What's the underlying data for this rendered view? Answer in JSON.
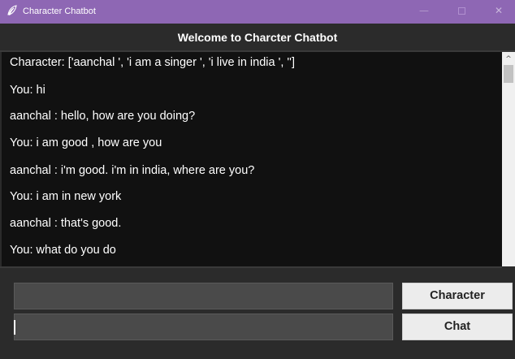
{
  "window": {
    "title": "Character Chatbot",
    "icon": "feather-icon",
    "controls": {
      "minimize": "—",
      "close": "✕"
    }
  },
  "header": {
    "title": "Welcome to Charcter Chatbot"
  },
  "chat": {
    "messages": [
      "Character: ['aanchal ', 'i am a singer ', 'i live in india ', '']",
      "You: hi",
      "aanchal : hello, how are you doing?",
      "You: i am good , how are you",
      "aanchal : i'm good. i'm in india, where are you?",
      "You: i am in new york",
      "aanchal : that's good.",
      "You: what do you do"
    ]
  },
  "scrollbar": {
    "up": "^",
    "down": "⌄"
  },
  "inputs": {
    "character_value": "",
    "chat_value": ""
  },
  "buttons": {
    "character_label": "Character",
    "chat_label": "Chat"
  },
  "colors": {
    "titlebar": "#8e67b4",
    "background": "#2b2b2b",
    "chat_bg": "#111111",
    "button_bg": "#ececec"
  }
}
